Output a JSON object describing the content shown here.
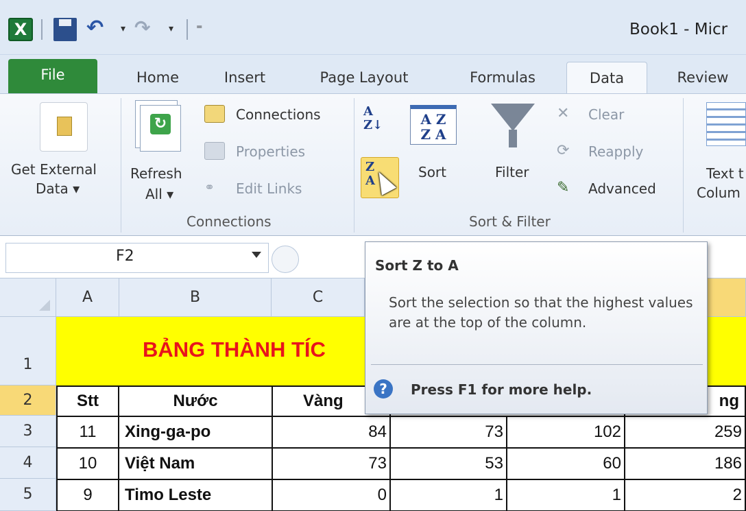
{
  "window": {
    "title": "Book1 - Micr"
  },
  "qat": {
    "logo": "X",
    "undo": "↶",
    "redo": "↷",
    "dropdown": "▾",
    "more": "⁼"
  },
  "tabs": [
    {
      "label": "File"
    },
    {
      "label": "Home"
    },
    {
      "label": "Insert"
    },
    {
      "label": "Page Layout"
    },
    {
      "label": "Formulas"
    },
    {
      "label": "Data"
    },
    {
      "label": "Review"
    }
  ],
  "ribbon": {
    "get_external": {
      "line1": "Get External",
      "line2": "Data ▾"
    },
    "refresh": {
      "line1": "Refresh",
      "line2": "All ▾"
    },
    "connections": {
      "connections": "Connections",
      "properties": "Properties",
      "edit_links": "Edit Links",
      "group": "Connections"
    },
    "sort_filter": {
      "sort": "Sort",
      "filter": "Filter",
      "clear": "Clear",
      "reapply": "Reapply",
      "advanced": "Advanced",
      "group": "Sort & Filter"
    },
    "text_to_columns": {
      "line1": "Text t",
      "line2": "Colum"
    }
  },
  "formula_bar": {
    "name_box": "F2"
  },
  "grid": {
    "columns": [
      "A",
      "B",
      "C"
    ],
    "rows": [
      "1",
      "2",
      "3",
      "4",
      "5"
    ],
    "title": "BẢNG THÀNH TÍC",
    "header": {
      "stt": "Stt",
      "nuoc": "Nước",
      "vang": "Vàng",
      "tong": "ng"
    },
    "data": [
      {
        "stt": "11",
        "nuoc": "Xing-ga-po",
        "c": "84",
        "d": "73",
        "e": "102",
        "f": "259"
      },
      {
        "stt": "10",
        "nuoc": "Việt Nam",
        "c": "73",
        "d": "53",
        "e": "60",
        "f": "186"
      },
      {
        "stt": "9",
        "nuoc": "Timo Leste",
        "c": "0",
        "d": "1",
        "e": "1",
        "f": "2"
      }
    ]
  },
  "tooltip": {
    "title": "Sort Z to A",
    "body": "Sort the selection so that the highest values are at the top of the column.",
    "help_glyph": "?",
    "help": "Press F1 for more help."
  },
  "colors": {
    "file_tab": "#2f8a3a",
    "title_fill": "#ffff00",
    "title_text": "#e8141c",
    "selected_header": "#f8d977"
  }
}
